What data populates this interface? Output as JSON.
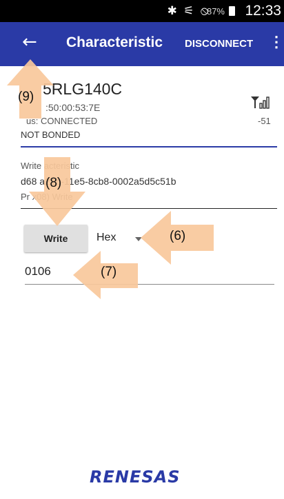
{
  "status_bar": {
    "icons": "✱ ⚟ ⦸",
    "battery_percent": "87%",
    "time": "12:33"
  },
  "app_bar": {
    "back_icon": "←",
    "title": "Characteristic",
    "action": "DISCONNECT",
    "overflow_icon": "⋮"
  },
  "device": {
    "name": "5RLG140C",
    "mac": ":50:00:53:7E",
    "status": "us:  CONNECTED",
    "bond_state": "NOT BONDED",
    "rssi": "-51",
    "signal_icon": "signal-strength-icon"
  },
  "characteristic": {
    "title": "Write         acteristic",
    "uuid": "d68             a21b-11e5-8cb8-0002a5d5c51b",
    "properties": "Pr                    x08) Write"
  },
  "write_form": {
    "button_label": "Write",
    "format": "Hex",
    "value": "0106"
  },
  "annotations": {
    "callouts": [
      "(9)",
      "(8)",
      "(6)",
      "(7)"
    ],
    "arrow_color": "#f9c89b"
  },
  "footer": {
    "logo": "RENESAS"
  },
  "colors": {
    "app_bar": "#2a3aa6",
    "status_bar": "#000000",
    "button": "#e0e0e0"
  }
}
